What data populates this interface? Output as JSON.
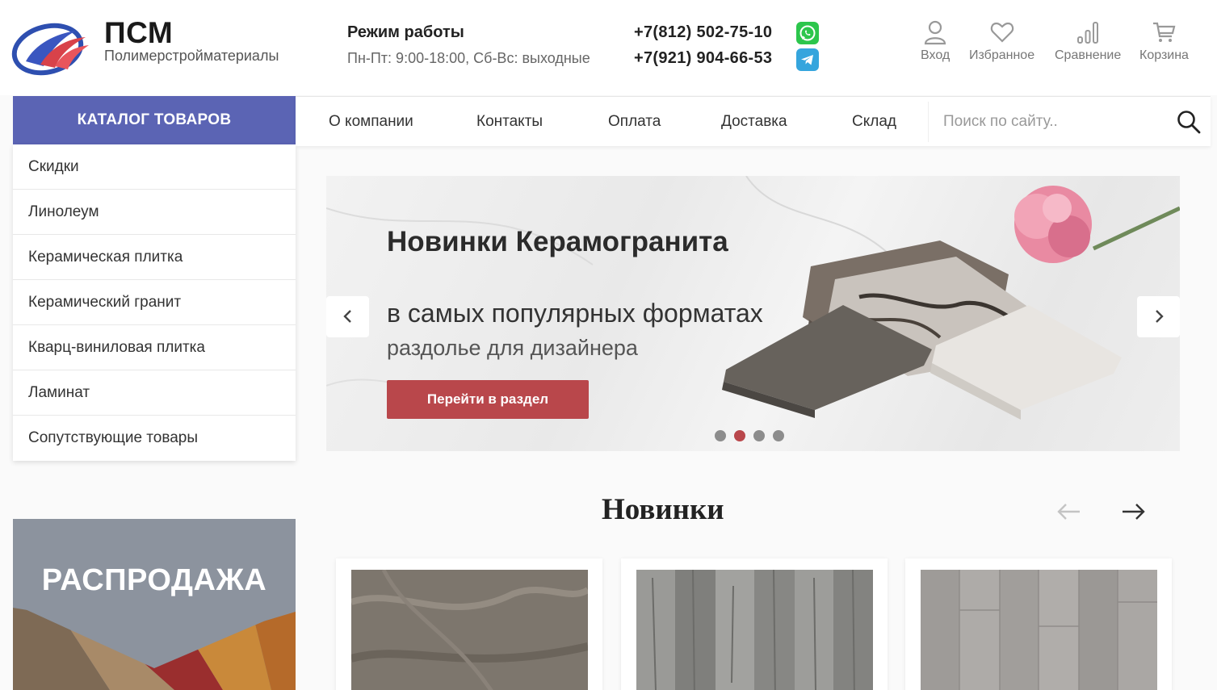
{
  "header": {
    "brand_name": "ПСМ",
    "brand_subtitle": "Полимерстройматериалы",
    "hours_title": "Режим работы",
    "hours_text": "Пн-Пт: 9:00-18:00, Сб-Вс: выходные",
    "phones": [
      "+7(812) 502-75-10",
      "+7(921) 904-66-53"
    ],
    "actions": [
      {
        "label": "Вход",
        "icon": "user-icon"
      },
      {
        "label": "Избранное",
        "icon": "heart-icon"
      },
      {
        "label": "Сравнение",
        "icon": "compare-icon"
      },
      {
        "label": "Корзина",
        "icon": "cart-icon"
      }
    ]
  },
  "nav": {
    "catalog_label": "КАТАЛОГ ТОВАРОВ",
    "items": [
      "О компании",
      "Контакты",
      "Оплата",
      "Доставка",
      "Склад"
    ],
    "search_placeholder": "Поиск по сайту.."
  },
  "sidebar": {
    "items": [
      "Скидки",
      "Линолеум",
      "Керамическая плитка",
      "Керамический гранит",
      "Кварц-виниловая плитка",
      "Ламинат",
      "Сопутствующие товары"
    ]
  },
  "sale": {
    "title": "РАСПРОДАЖА"
  },
  "banner": {
    "title": "Новинки Керамогранита",
    "subtitle1": "в самых популярных форматах",
    "subtitle2": "раздолье для дизайнера",
    "button_label": "Перейти в раздел",
    "slide_count": 4,
    "active_slide": 2
  },
  "new_items": {
    "title": "Новинки"
  },
  "colors": {
    "accent": "#5b64b4",
    "button": "#b9474b",
    "whatsapp": "#2cc64c",
    "telegram": "#35a5dd"
  }
}
